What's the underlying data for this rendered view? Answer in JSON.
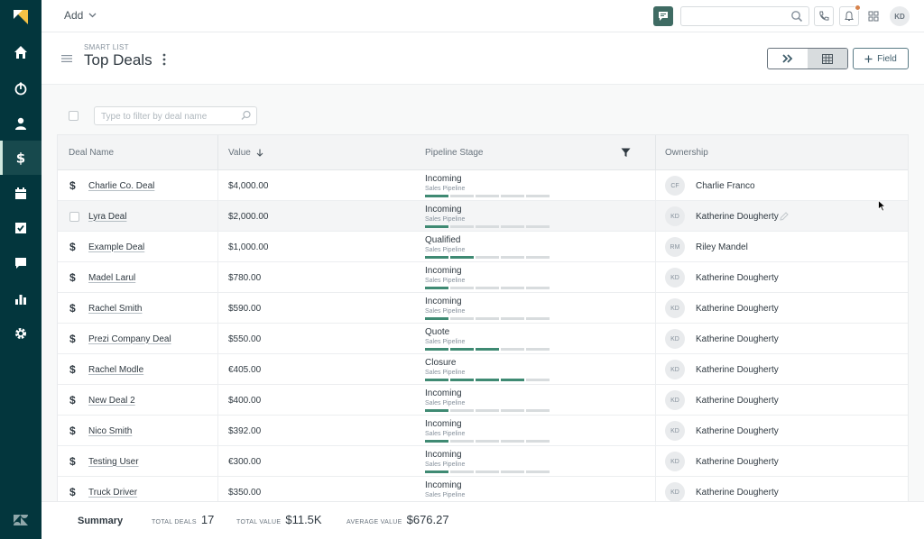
{
  "topbar": {
    "add_label": "Add",
    "search_placeholder": "",
    "user_initials": "KD"
  },
  "header": {
    "eyebrow": "SMART LIST",
    "title": "Top Deals",
    "field_button": "Field"
  },
  "filter": {
    "placeholder": "Type to filter by deal name"
  },
  "table": {
    "columns": {
      "deal_name": "Deal Name",
      "value": "Value",
      "pipeline_stage": "Pipeline Stage",
      "ownership": "Ownership"
    },
    "pipeline_label": "Sales Pipeline",
    "rows": [
      {
        "name": "Charlie Co. Deal",
        "value": "$4,000.00",
        "stage": "Incoming",
        "stage_step": 1,
        "owner_initials": "CF",
        "owner": "Charlie Franco"
      },
      {
        "name": "Lyra Deal",
        "value": "$2,000.00",
        "stage": "Incoming",
        "stage_step": 1,
        "owner_initials": "KD",
        "owner": "Katherine Dougherty"
      },
      {
        "name": "Example Deal",
        "value": "$1,000.00",
        "stage": "Qualified",
        "stage_step": 2,
        "owner_initials": "RM",
        "owner": "Riley Mandel"
      },
      {
        "name": "Madel Larul",
        "value": "$780.00",
        "stage": "Incoming",
        "stage_step": 1,
        "owner_initials": "KD",
        "owner": "Katherine Dougherty"
      },
      {
        "name": "Rachel Smith",
        "value": "$590.00",
        "stage": "Incoming",
        "stage_step": 1,
        "owner_initials": "KD",
        "owner": "Katherine Dougherty"
      },
      {
        "name": "Prezi Company Deal",
        "value": "$550.00",
        "stage": "Quote",
        "stage_step": 3,
        "owner_initials": "KD",
        "owner": "Katherine Dougherty"
      },
      {
        "name": "Rachel Modle",
        "value": "€405.00",
        "stage": "Closure",
        "stage_step": 4,
        "owner_initials": "KD",
        "owner": "Katherine Dougherty"
      },
      {
        "name": "New Deal 2",
        "value": "$400.00",
        "stage": "Incoming",
        "stage_step": 1,
        "owner_initials": "KD",
        "owner": "Katherine Dougherty"
      },
      {
        "name": "Nico Smith",
        "value": "$392.00",
        "stage": "Incoming",
        "stage_step": 1,
        "owner_initials": "KD",
        "owner": "Katherine Dougherty"
      },
      {
        "name": "Testing User",
        "value": "€300.00",
        "stage": "Incoming",
        "stage_step": 1,
        "owner_initials": "KD",
        "owner": "Katherine Dougherty"
      },
      {
        "name": "Truck Driver",
        "value": "$350.00",
        "stage": "Incoming",
        "stage_step": 1,
        "owner_initials": "KD",
        "owner": "Katherine Dougherty"
      }
    ]
  },
  "summary": {
    "title": "Summary",
    "total_deals_label": "TOTAL DEALS",
    "total_deals": "17",
    "total_value_label": "TOTAL VALUE",
    "total_value": "$11.5K",
    "average_value_label": "AVERAGE VALUE",
    "average_value": "$676.27"
  },
  "colors": {
    "sidebar": "#03363d",
    "stage_progress": "#3f8a73",
    "accent_dot": "#d6834d"
  }
}
